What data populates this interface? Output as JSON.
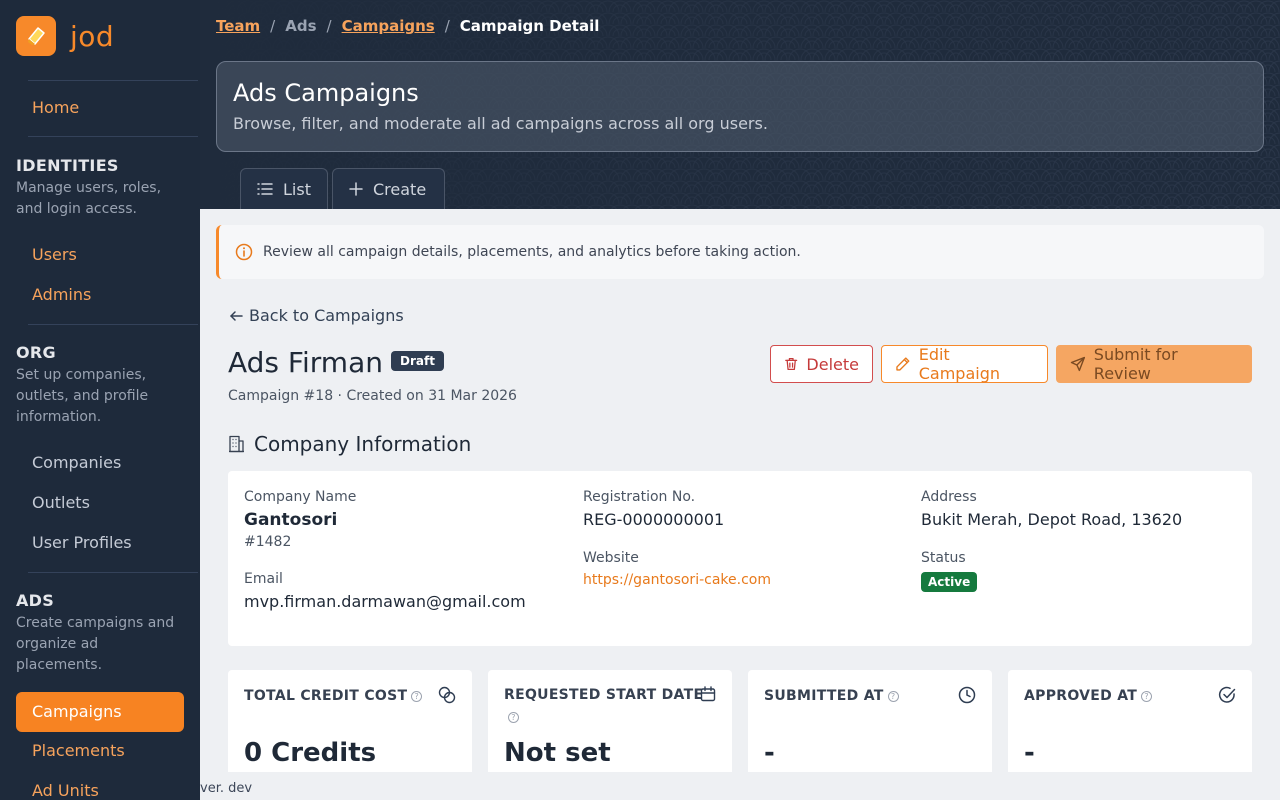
{
  "brand": {
    "name": "jod",
    "accent": "#f78322"
  },
  "sidebar": {
    "home": "Home",
    "identities": {
      "title": "IDENTITIES",
      "desc": "Manage users, roles, and login access.",
      "items": [
        "Users",
        "Admins"
      ]
    },
    "org": {
      "title": "ORG",
      "desc": "Set up companies, outlets, and profile information.",
      "items": [
        "Companies",
        "Outlets",
        "User Profiles"
      ]
    },
    "ads": {
      "title": "ADS",
      "desc": "Create campaigns and organize ad placements.",
      "items": [
        "Campaigns",
        "Placements",
        "Ad Units"
      ]
    },
    "version": "ver. dev"
  },
  "breadcrumb": {
    "team": "Team",
    "ads": "Ads",
    "campaigns": "Campaigns",
    "current": "Campaign Detail"
  },
  "header": {
    "title": "Ads Campaigns",
    "subtitle": "Browse, filter, and moderate all ad campaigns across all org users."
  },
  "tabs": {
    "list": "List",
    "create": "Create"
  },
  "alert": "Review all campaign details, placements, and analytics before taking action.",
  "detail": {
    "back": "Back to Campaigns",
    "title": "Ads Firman",
    "status": "Draft",
    "meta": "Campaign #18 · Created on 31 Mar 2026",
    "actions": {
      "delete": "Delete",
      "edit": "Edit Campaign",
      "submit": "Submit for Review"
    }
  },
  "company": {
    "section_title": "Company Information",
    "name_label": "Company Name",
    "name": "Gantosori",
    "id": "#1482",
    "email_label": "Email",
    "email": "mvp.firman.darmawan@gmail.com",
    "reg_label": "Registration No.",
    "reg": "REG-0000000001",
    "website_label": "Website",
    "website": "https://gantosori-cake.com",
    "address_label": "Address",
    "address": "Bukit Merah, Depot Road, 13620",
    "status_label": "Status",
    "status": "Active"
  },
  "stats": {
    "credit": {
      "label": "TOTAL CREDIT COST",
      "value": "0 Credits"
    },
    "start": {
      "label": "REQUESTED START DATE",
      "value": "Not set"
    },
    "submitted": {
      "label": "SUBMITTED AT",
      "value": "-"
    },
    "approved": {
      "label": "APPROVED AT",
      "value": "-"
    }
  }
}
